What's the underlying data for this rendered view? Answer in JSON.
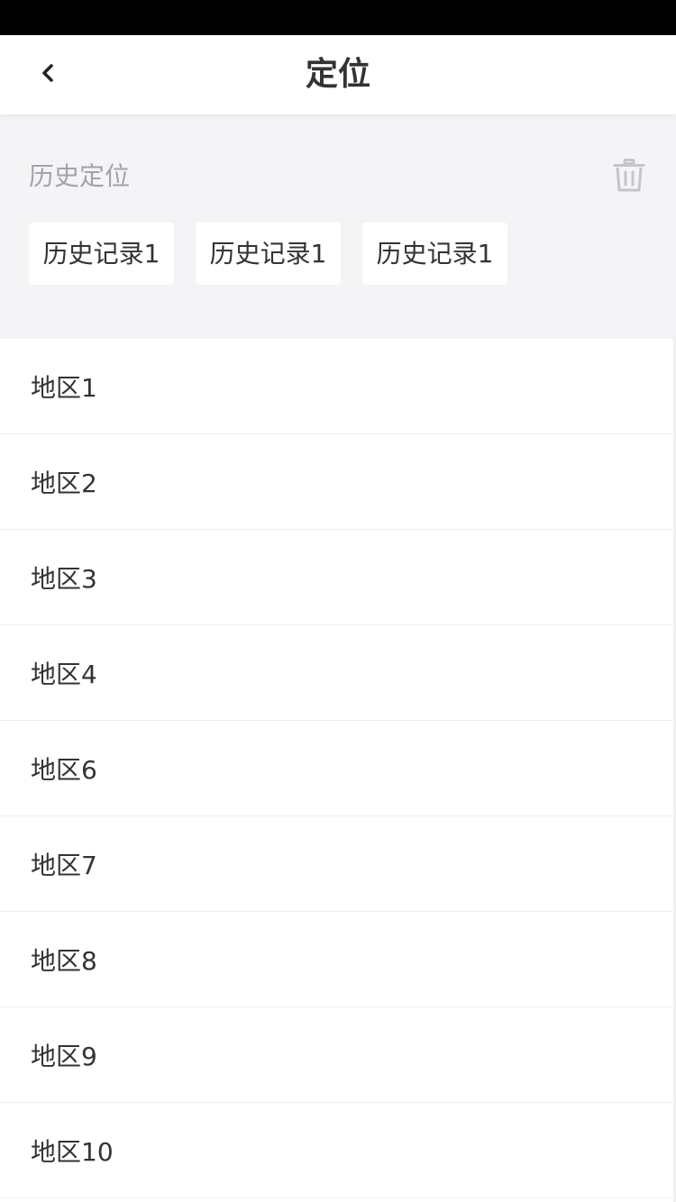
{
  "header": {
    "title": "定位",
    "back_icon": "chevron-left-icon"
  },
  "history": {
    "title": "历史定位",
    "clear_icon": "trash-icon",
    "items": [
      {
        "label": "历史记录1"
      },
      {
        "label": "历史记录1"
      },
      {
        "label": "历史记录1"
      }
    ]
  },
  "regions": [
    {
      "label": "地区1"
    },
    {
      "label": "地区2"
    },
    {
      "label": "地区3"
    },
    {
      "label": "地区4"
    },
    {
      "label": "地区6"
    },
    {
      "label": "地区7"
    },
    {
      "label": "地区8"
    },
    {
      "label": "地区9"
    },
    {
      "label": "地区10"
    }
  ],
  "colors": {
    "status_bar": "#000000",
    "section_background": "#f4f4f6",
    "secondary_text": "#a3a3a8",
    "primary_text": "#333333"
  }
}
